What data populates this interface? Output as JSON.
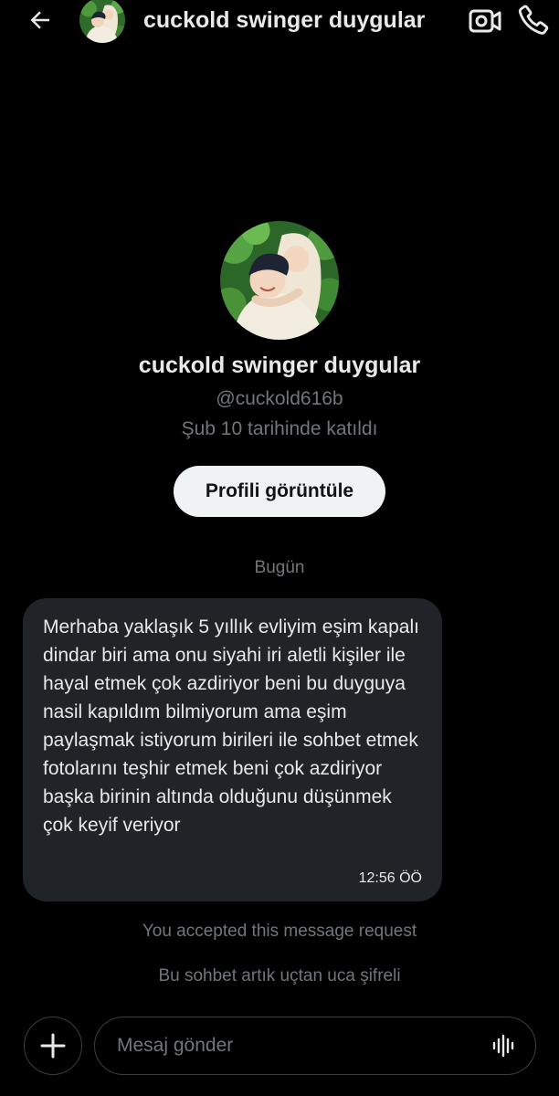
{
  "header": {
    "title": "cuckold swinger duygular"
  },
  "profile": {
    "name": "cuckold swinger duygular",
    "handle": "@cuckold616b",
    "joined": "Şub 10 tarihinde katıldı",
    "view_profile_label": "Profili görüntüle"
  },
  "conversation": {
    "date_separator": "Bugün",
    "messages": [
      {
        "text": "Merhaba yaklaşık 5 yıllık evliyim eşim kapalı dindar biri ama onu siyahi iri aletli kişiler ile hayal etmek çok azdiriyor beni bu duyguya nasil kapıldım bilmiyorum ama eşim paylaşmak istiyorum birileri ile sohbet etmek fotolarını teşhir etmek beni çok azdiriyor başka birinin altında olduğunu düşünmek çok keyif veriyor",
        "time": "12:56 ÖÖ"
      }
    ],
    "system_notes": [
      "You accepted this message request",
      "Bu sohbet artık uçtan uca şifreli"
    ]
  },
  "composer": {
    "placeholder": "Mesaj gönder"
  },
  "icons": {
    "back": "arrow-left-icon",
    "video": "video-camera-icon",
    "call": "phone-icon",
    "plus": "plus-icon",
    "voice": "voice-wave-icon"
  },
  "colors": {
    "background": "#000000",
    "bubble": "#202327",
    "primary_text": "#e7e9ea",
    "secondary_text": "#71767b",
    "button_bg": "#eff3f4"
  }
}
